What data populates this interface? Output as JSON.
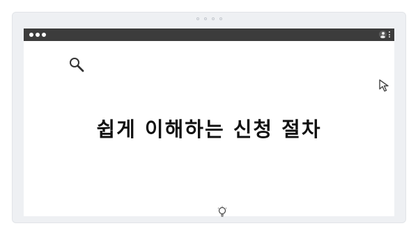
{
  "page": {
    "headline": "쉽게 이해하는 신청 절차"
  },
  "colors": {
    "titlebar": "#3c3c3c",
    "frame_background": "#eef0f3",
    "content_background": "#ffffff",
    "headline_text": "#111111"
  },
  "icons": {
    "top_pager": "pager-dots-icon",
    "window_controls": "window-dots-icon",
    "profile": "profile-icon",
    "menu": "kebab-menu-icon",
    "search": "search-icon",
    "cursor": "cursor-icon",
    "bulb": "lightbulb-icon"
  }
}
